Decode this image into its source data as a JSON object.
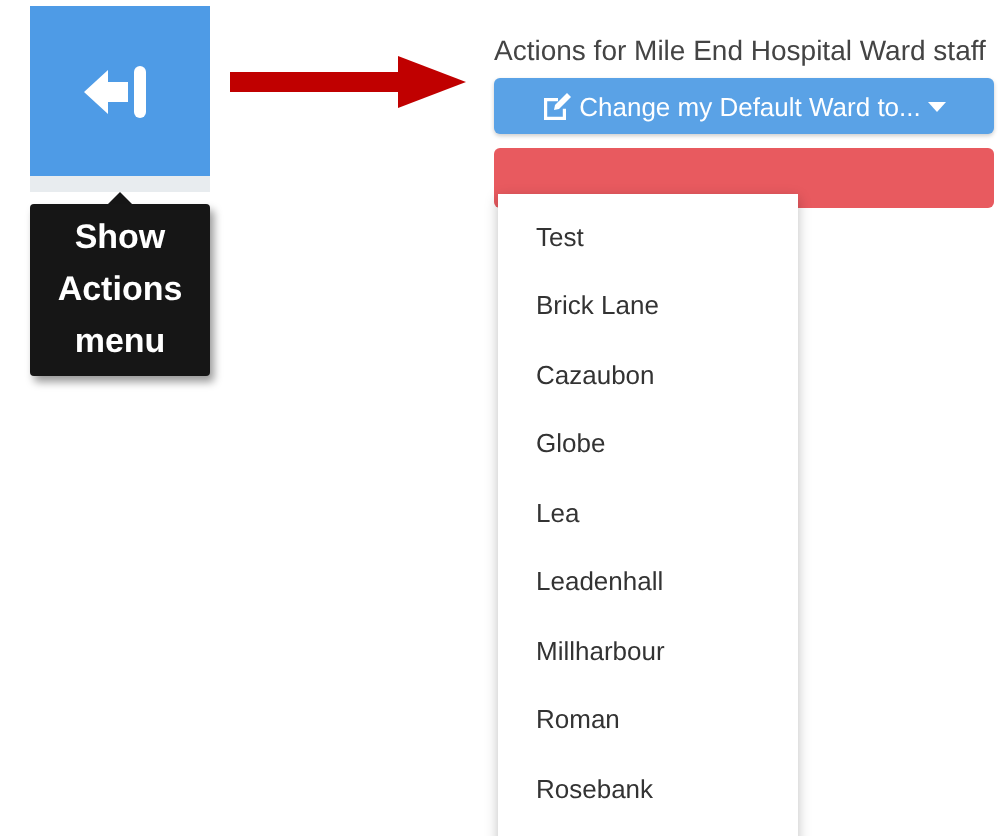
{
  "tooltip": {
    "text": "Show Actions menu"
  },
  "panel": {
    "title": "Actions for Mile End Hospital Ward staff",
    "dropdown_button": {
      "label": "Change my Default Ward to...",
      "expanded": true
    },
    "menu_items": [
      {
        "label": "Test"
      },
      {
        "label": "Brick Lane"
      },
      {
        "label": "Cazaubon"
      },
      {
        "label": "Globe"
      },
      {
        "label": "Lea"
      },
      {
        "label": "Leadenhall"
      },
      {
        "label": "Millharbour"
      },
      {
        "label": "Roman"
      },
      {
        "label": "Rosebank"
      }
    ]
  }
}
